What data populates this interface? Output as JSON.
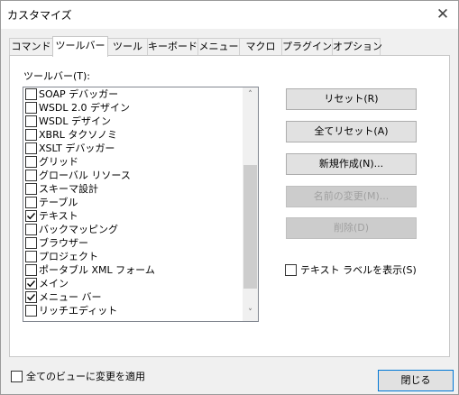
{
  "window": {
    "title": "カスタマイズ",
    "close_glyph": "✕"
  },
  "tabs": [
    {
      "label": "コマンド",
      "active": false
    },
    {
      "label": "ツールバー",
      "active": true
    },
    {
      "label": "ツール",
      "active": false
    },
    {
      "label": "キーボード",
      "active": false
    },
    {
      "label": "メニュー",
      "active": false
    },
    {
      "label": "マクロ",
      "active": false
    },
    {
      "label": "プラグイン",
      "active": false
    },
    {
      "label": "オプション",
      "active": false
    }
  ],
  "toolbars_panel": {
    "list_label": "ツールバー(T):",
    "items": [
      {
        "label": "SOAP デバッガー",
        "checked": false
      },
      {
        "label": "WSDL 2.0 デザイン",
        "checked": false
      },
      {
        "label": "WSDL デザイン",
        "checked": false
      },
      {
        "label": "XBRL タクソノミ",
        "checked": false
      },
      {
        "label": "XSLT デバッガー",
        "checked": false
      },
      {
        "label": "グリッド",
        "checked": false
      },
      {
        "label": "グローバル リソース",
        "checked": false
      },
      {
        "label": "スキーマ設計",
        "checked": false
      },
      {
        "label": "テーブル",
        "checked": false
      },
      {
        "label": "テキスト",
        "checked": true
      },
      {
        "label": "バックマッピング",
        "checked": false
      },
      {
        "label": "ブラウザー",
        "checked": false
      },
      {
        "label": "プロジェクト",
        "checked": false
      },
      {
        "label": "ポータブル XML フォーム",
        "checked": false
      },
      {
        "label": "メイン",
        "checked": true
      },
      {
        "label": "メニュー バー",
        "checked": true
      },
      {
        "label": "リッチエディット",
        "checked": false
      }
    ],
    "scroll_up_glyph": "˄",
    "scroll_down_glyph": "˅"
  },
  "buttons": {
    "reset": "リセット(R)",
    "reset_all": "全てリセット(A)",
    "new": "新規作成(N)...",
    "rename": "名前の変更(M)...",
    "delete": "削除(D)"
  },
  "show_text_labels": {
    "label": "テキスト ラベルを表示(S)",
    "checked": false
  },
  "apply_all_views": {
    "label": "全てのビューに変更を適用",
    "checked": false
  },
  "close_button": "閉じる"
}
